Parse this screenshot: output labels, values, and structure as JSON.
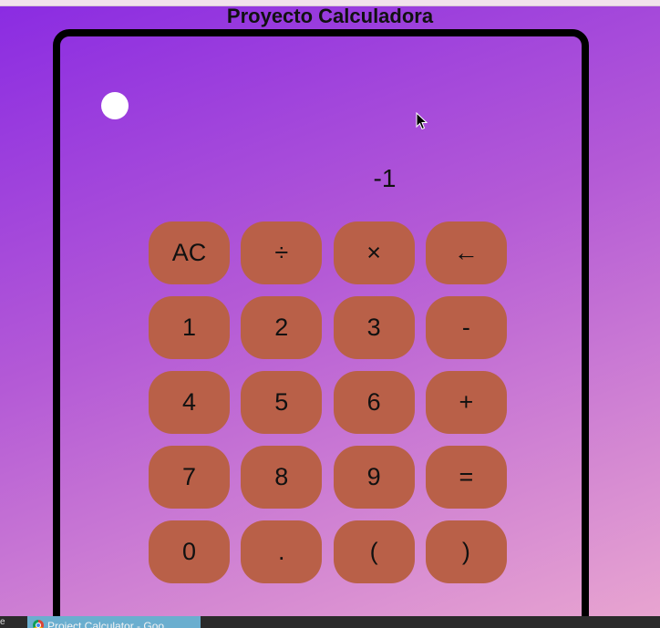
{
  "page": {
    "title": "Proyecto Calculadora"
  },
  "display": {
    "value": "-1"
  },
  "keypad": {
    "rows": [
      [
        "AC",
        "÷",
        "×",
        "←"
      ],
      [
        "1",
        "2",
        "3",
        "-"
      ],
      [
        "4",
        "5",
        "6",
        "+"
      ],
      [
        "7",
        "8",
        "9",
        "="
      ],
      [
        "0",
        ".",
        "(",
        ")"
      ]
    ]
  },
  "taskbar": {
    "edge_text": "e",
    "window_label": "Project Calculator - Goo"
  },
  "icons": {
    "cursor": "mouse-pointer-icon",
    "browser": "chrome-icon",
    "indicator": "white-circle-icon"
  },
  "colors": {
    "key_background": "#b96048",
    "frame_border": "#000000",
    "taskbar_item": "#6aaecf"
  }
}
